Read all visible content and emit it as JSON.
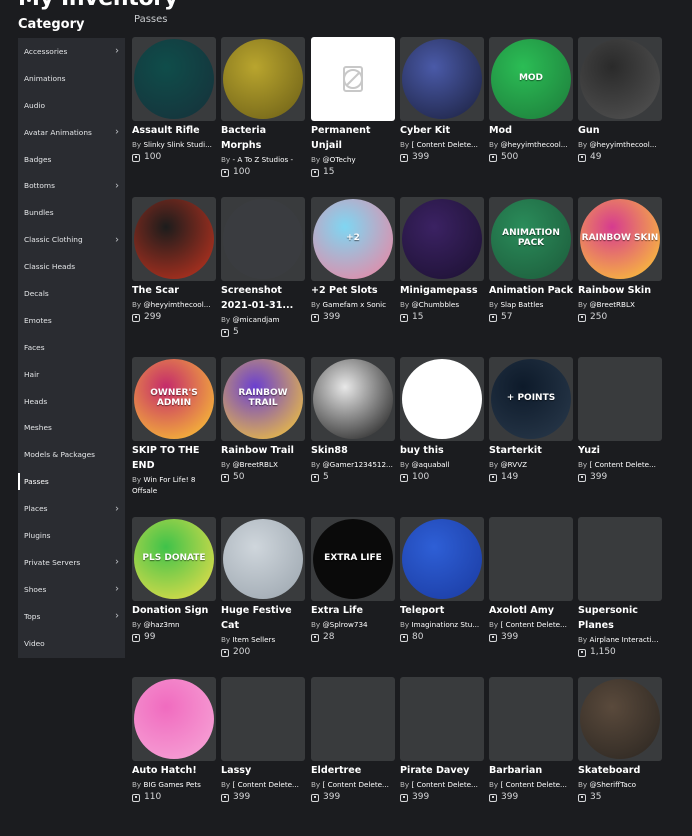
{
  "page": {
    "title": "My Inventory",
    "category_heading": "Category",
    "section_title": "Passes"
  },
  "sidebar": {
    "items": [
      {
        "label": "Accessories",
        "has_submenu": true
      },
      {
        "label": "Animations",
        "has_submenu": false
      },
      {
        "label": "Audio",
        "has_submenu": false
      },
      {
        "label": "Avatar Animations",
        "has_submenu": true
      },
      {
        "label": "Badges",
        "has_submenu": false
      },
      {
        "label": "Bottoms",
        "has_submenu": true
      },
      {
        "label": "Bundles",
        "has_submenu": false
      },
      {
        "label": "Classic Clothing",
        "has_submenu": true
      },
      {
        "label": "Classic Heads",
        "has_submenu": false
      },
      {
        "label": "Decals",
        "has_submenu": false
      },
      {
        "label": "Emotes",
        "has_submenu": false
      },
      {
        "label": "Faces",
        "has_submenu": false
      },
      {
        "label": "Hair",
        "has_submenu": false
      },
      {
        "label": "Heads",
        "has_submenu": false
      },
      {
        "label": "Meshes",
        "has_submenu": false
      },
      {
        "label": "Models & Packages",
        "has_submenu": false
      },
      {
        "label": "Passes",
        "has_submenu": false,
        "active": true
      },
      {
        "label": "Places",
        "has_submenu": true
      },
      {
        "label": "Plugins",
        "has_submenu": false
      },
      {
        "label": "Private Servers",
        "has_submenu": true
      },
      {
        "label": "Shoes",
        "has_submenu": true
      },
      {
        "label": "Tops",
        "has_submenu": true
      },
      {
        "label": "Video",
        "has_submenu": false
      }
    ]
  },
  "icons": {
    "chevron": "chevron-right-icon",
    "currency": "robux-icon",
    "placeholder": "missing-image-icon"
  },
  "items": [
    {
      "name": "Assault Rifle",
      "by": "By",
      "creator": "Slinky Slink Studi...",
      "price": "100",
      "art": {
        "bg": "#0f4d4a",
        "ring": "#16303a",
        "text": ""
      }
    },
    {
      "name": "Bacteria Morphs",
      "by": "By",
      "creator": "- A To Z Studios -",
      "price": "100",
      "art": {
        "bg": "#b9a52e",
        "ring": "#6a5d16",
        "text": ""
      }
    },
    {
      "name": "Permanent Unjail",
      "by": "By",
      "creator": "@OTechy",
      "price": "15",
      "art": {
        "bg": "",
        "ring": "",
        "text": "",
        "placeholder": true
      }
    },
    {
      "name": "Cyber Kit",
      "by": "By",
      "creator": "[ Content Delete...",
      "price": "399",
      "art": {
        "bg": "#4a5aa8",
        "ring": "#1a1f3c",
        "text": ""
      }
    },
    {
      "name": "Mod",
      "by": "By",
      "creator": "@heyyimthecool...",
      "price": "500",
      "art": {
        "bg": "#2bbd55",
        "ring": "#1d7a3a",
        "text": "MOD"
      }
    },
    {
      "name": "Gun",
      "by": "By",
      "creator": "@heyyimthecool...",
      "price": "49",
      "art": {
        "bg": "#2a2a2a",
        "ring": "#555555",
        "text": ""
      }
    },
    {
      "name": "The Scar",
      "by": "By",
      "creator": "@heyyimthecool...",
      "price": "299",
      "art": {
        "bg": "#1c1c1c",
        "ring": "#c8341f",
        "text": ""
      }
    },
    {
      "name": "Screenshot 2021-01-31...",
      "by": "By",
      "creator": "@micandjam",
      "price": "5",
      "art": {
        "bg": "#3a3c40",
        "ring": "#3a3c40",
        "text": ""
      }
    },
    {
      "name": "+2 Pet Slots",
      "by": "By",
      "creator": "Gamefam x Sonic",
      "price": "399",
      "art": {
        "bg": "#7fd6f2",
        "ring": "#f27f9c",
        "text": "+2"
      }
    },
    {
      "name": "Minigamepass",
      "by": "By",
      "creator": "@Chumbbles",
      "price": "15",
      "art": {
        "bg": "#3b2263",
        "ring": "#1b1030",
        "text": ""
      }
    },
    {
      "name": "Animation Pack",
      "by": "By",
      "creator": "Slap Battles",
      "price": "57",
      "art": {
        "bg": "#2a8c5a",
        "ring": "#1c5a3a",
        "text": "ANIMATION PACK"
      }
    },
    {
      "name": "Rainbow Skin",
      "by": "By",
      "creator": "@BreetRBLX",
      "price": "250",
      "art": {
        "bg": "#d63b8f",
        "ring": "#ffd12e",
        "text": "RAINBOW SKIN"
      }
    },
    {
      "name": "SKIP TO THE END",
      "by": "By",
      "creator": "Win For Life! 8 Offsale",
      "price": "",
      "art": {
        "bg": "#c42a6b",
        "ring": "#ffd12e",
        "text": "OWNER'S ADMIN"
      }
    },
    {
      "name": "Rainbow Trail",
      "by": "By",
      "creator": "@BreetRBLX",
      "price": "50",
      "art": {
        "bg": "#6a3fd0",
        "ring": "#ffd12e",
        "text": "RAINBOW TRAIL"
      }
    },
    {
      "name": "Skin88",
      "by": "By",
      "creator": "@Gamer1234512...",
      "price": "5",
      "art": {
        "bg": "#e8e8e8",
        "ring": "#111111",
        "text": ""
      }
    },
    {
      "name": "buy this",
      "by": "By",
      "creator": "@aquaball",
      "price": "100",
      "art": {
        "bg": "#ffffff",
        "ring": "#ffffff",
        "text": ""
      }
    },
    {
      "name": "Starterkit",
      "by": "By",
      "creator": "@RVVZ",
      "price": "149",
      "art": {
        "bg": "#0d1a2a",
        "ring": "#2a3a4c",
        "text": "+ POINTS"
      }
    },
    {
      "name": "Yuzi",
      "by": "By",
      "creator": "[ Content Delete...",
      "price": "399",
      "art": {
        "bg": "#393b3d",
        "ring": "#393b3d",
        "text": ""
      }
    },
    {
      "name": "Donation Sign",
      "by": "By",
      "creator": "@haz3mn",
      "price": "99",
      "art": {
        "bg": "#3fc24a",
        "ring": "#f5e04a",
        "text": "PLS DONATE"
      }
    },
    {
      "name": "Huge Festive Cat",
      "by": "By",
      "creator": "Item Sellers",
      "price": "200",
      "art": {
        "bg": "#cfd6dc",
        "ring": "#9aa4ad",
        "text": ""
      }
    },
    {
      "name": "Extra Life",
      "by": "By",
      "creator": "@Splrow734",
      "price": "28",
      "art": {
        "bg": "#0a0a0a",
        "ring": "#0a0a0a",
        "text": "EXTRA LIFE"
      }
    },
    {
      "name": "Teleport",
      "by": "By",
      "creator": "Imaginationz Stu...",
      "price": "80",
      "art": {
        "bg": "#2e5fd6",
        "ring": "#1a3aa0",
        "text": ""
      }
    },
    {
      "name": "Axolotl Amy",
      "by": "By",
      "creator": "[ Content Delete...",
      "price": "399",
      "art": {
        "bg": "#393b3d",
        "ring": "#393b3d",
        "text": ""
      }
    },
    {
      "name": "Supersonic Planes",
      "by": "By",
      "creator": "Airplane Interacti...",
      "price": "1,150",
      "art": {
        "bg": "#393b3d",
        "ring": "#393b3d",
        "text": ""
      }
    },
    {
      "name": "Auto Hatch!",
      "by": "By",
      "creator": "BIG Games Pets",
      "price": "110",
      "art": {
        "bg": "#f06bbf",
        "ring": "#f7a8d8",
        "text": ""
      }
    },
    {
      "name": "Lassy",
      "by": "By",
      "creator": "[ Content Delete...",
      "price": "399",
      "art": {
        "bg": "#393b3d",
        "ring": "#393b3d",
        "text": ""
      }
    },
    {
      "name": "Eldertree",
      "by": "By",
      "creator": "[ Content Delete...",
      "price": "399",
      "art": {
        "bg": "#393b3d",
        "ring": "#393b3d",
        "text": ""
      }
    },
    {
      "name": "Pirate Davey",
      "by": "By",
      "creator": "[ Content Delete...",
      "price": "399",
      "art": {
        "bg": "#393b3d",
        "ring": "#393b3d",
        "text": ""
      }
    },
    {
      "name": "Barbarian",
      "by": "By",
      "creator": "[ Content Delete...",
      "price": "399",
      "art": {
        "bg": "#393b3d",
        "ring": "#393b3d",
        "text": ""
      }
    },
    {
      "name": "Skateboard",
      "by": "By",
      "creator": "@SheriffTaco",
      "price": "35",
      "art": {
        "bg": "#5a4a3c",
        "ring": "#2a2520",
        "text": ""
      }
    }
  ]
}
